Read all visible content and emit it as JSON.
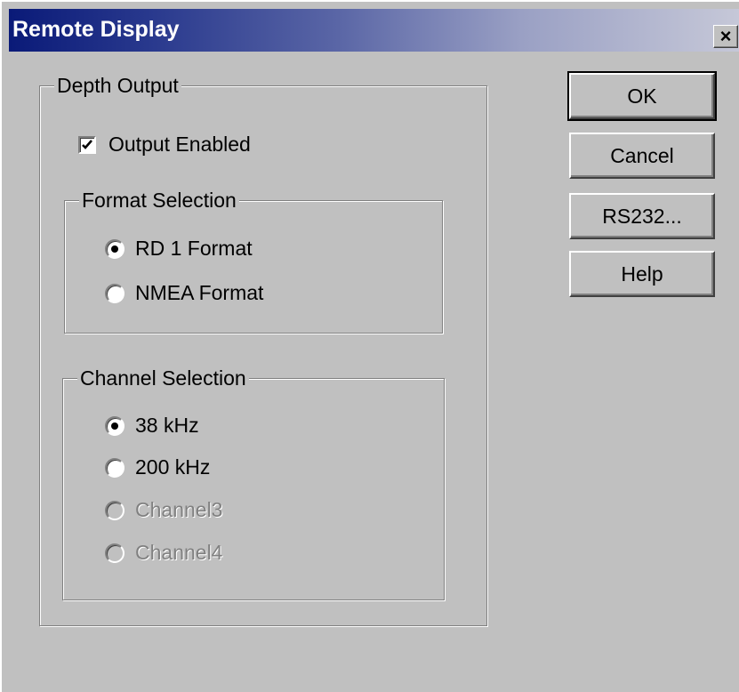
{
  "window": {
    "title": "Remote Display",
    "close_glyph": "×"
  },
  "depth_output": {
    "legend": "Depth Output",
    "output_enabled": {
      "label": "Output Enabled",
      "checked": true
    }
  },
  "format_selection": {
    "legend": "Format Selection",
    "options": [
      {
        "label": "RD 1 Format",
        "selected": true,
        "enabled": true
      },
      {
        "label": "NMEA Format",
        "selected": false,
        "enabled": true
      }
    ]
  },
  "channel_selection": {
    "legend": "Channel Selection",
    "options": [
      {
        "label": "38 kHz",
        "selected": true,
        "enabled": true
      },
      {
        "label": "200 kHz",
        "selected": false,
        "enabled": true
      },
      {
        "label": "Channel3",
        "selected": false,
        "enabled": false
      },
      {
        "label": "Channel4",
        "selected": false,
        "enabled": false
      }
    ]
  },
  "buttons": {
    "ok": "OK",
    "cancel": "Cancel",
    "rs232": "RS232...",
    "help": "Help"
  }
}
